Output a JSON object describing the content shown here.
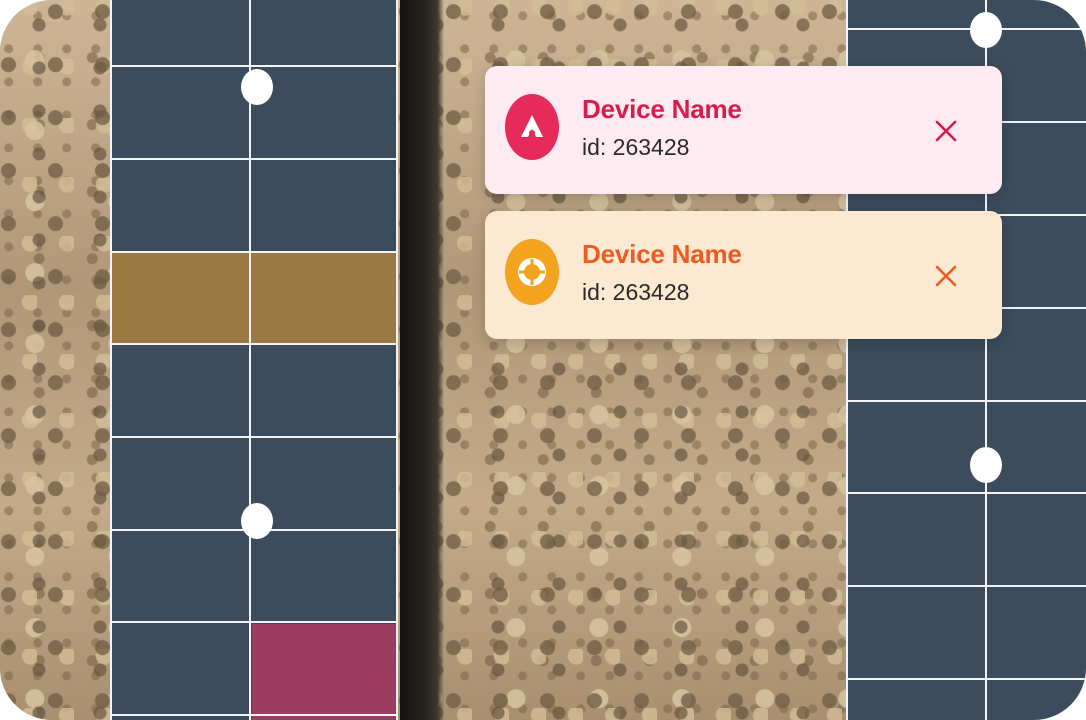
{
  "colors": {
    "grid_panel": "#3c4c5d",
    "grid_lines": "#f2f4f6",
    "highlight_ochre": "#9a7943",
    "highlight_crimson": "#9c3d5f"
  },
  "devices": [
    {
      "name": "Device Name",
      "id_text": "id: 263428",
      "icon": "triangle-logo-icon",
      "accent": "#e62b5b",
      "card_bg": "#fdebf1",
      "close_icon": "close-icon"
    },
    {
      "name": "Device Name",
      "id_text": "id: 263428",
      "icon": "lifebuoy-icon",
      "accent": "#f3a31e",
      "card_bg": "#fce9d2",
      "close_icon": "close-icon"
    }
  ]
}
